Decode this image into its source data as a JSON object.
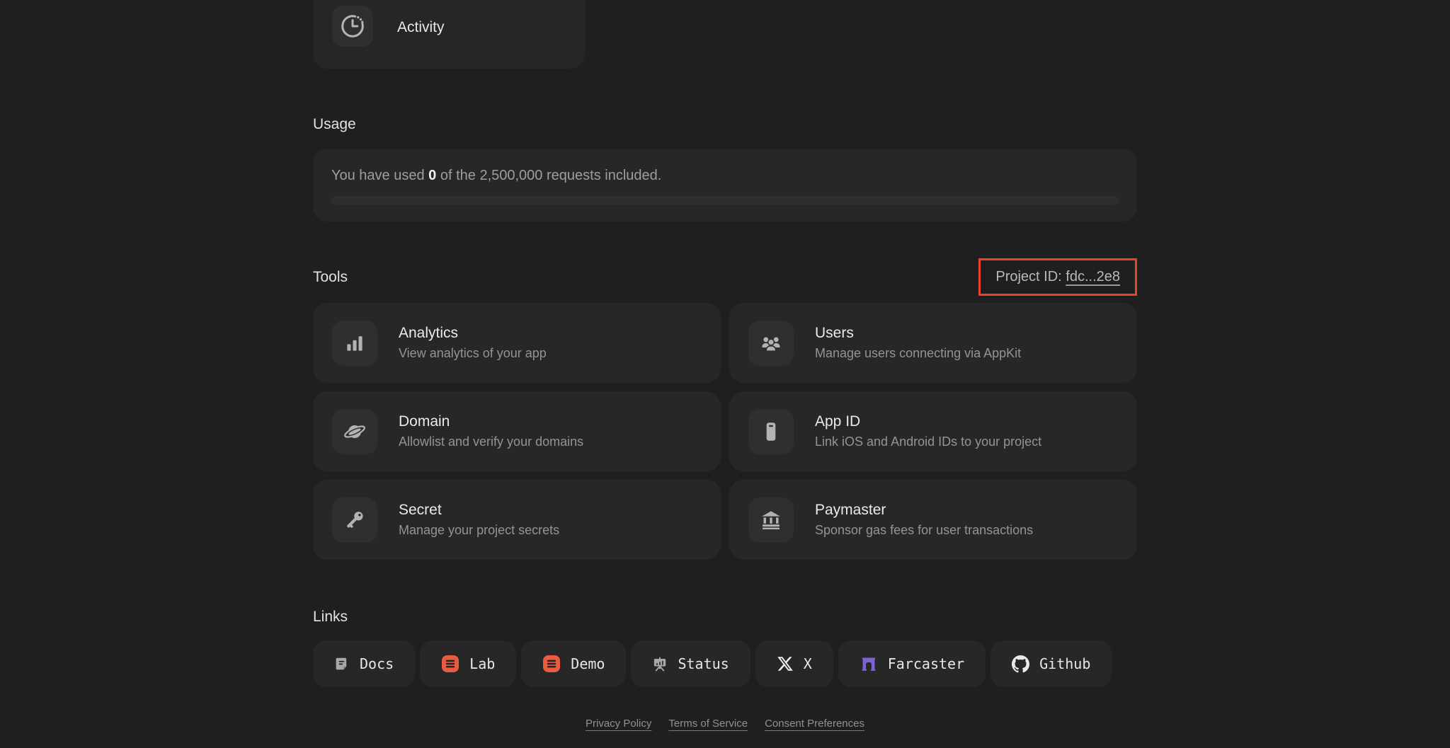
{
  "activity_card": {
    "label": "Activity",
    "icon": "clock-history-icon"
  },
  "usage": {
    "heading": "Usage",
    "text_prefix": "You have used ",
    "used_value": "0",
    "text_suffix": " of the 2,500,000 requests included.",
    "progress_percent": 0
  },
  "tools": {
    "heading": "Tools",
    "project_id": {
      "label": "Project ID: ",
      "value": "fdc...2e8",
      "highlight_color": "#e8432b"
    },
    "cards": [
      {
        "title": "Analytics",
        "description": "View analytics of your app",
        "icon": "bar-chart-icon"
      },
      {
        "title": "Users",
        "description": "Manage users connecting via AppKit",
        "icon": "users-icon"
      },
      {
        "title": "Domain",
        "description": "Allowlist and verify your domains",
        "icon": "planet-icon"
      },
      {
        "title": "App ID",
        "description": "Link iOS and Android IDs to your project",
        "icon": "smartphone-icon"
      },
      {
        "title": "Secret",
        "description": "Manage your project secrets",
        "icon": "key-icon"
      },
      {
        "title": "Paymaster",
        "description": "Sponsor gas fees for user transactions",
        "icon": "bank-icon"
      }
    ]
  },
  "links": {
    "heading": "Links",
    "buttons": [
      {
        "label": "Docs",
        "icon": "docs-icon"
      },
      {
        "label": "Lab",
        "icon": "lab-icon",
        "icon_color": "#eb5b41"
      },
      {
        "label": "Demo",
        "icon": "demo-icon",
        "icon_color": "#eb5b41"
      },
      {
        "label": "Status",
        "icon": "status-icon"
      },
      {
        "label": "X",
        "icon": "x-logo-icon"
      },
      {
        "label": "Farcaster",
        "icon": "farcaster-icon",
        "icon_color": "#7f63d2"
      },
      {
        "label": "Github",
        "icon": "github-icon"
      }
    ]
  },
  "footer": {
    "links": [
      "Privacy Policy",
      "Terms of Service",
      "Consent Preferences"
    ]
  },
  "colors": {
    "page_bg": "#1f1f20",
    "card_bg": "#272728",
    "icon_tile_bg": "#2f2f31",
    "annotation_red": "#e8432b",
    "lab_demo_icon_orange": "#eb5b41",
    "farcaster_purple": "#7f63d2",
    "progress_track": "#2e2e2f",
    "title_text": "#eaeaea",
    "subtitle_text": "#949494"
  }
}
